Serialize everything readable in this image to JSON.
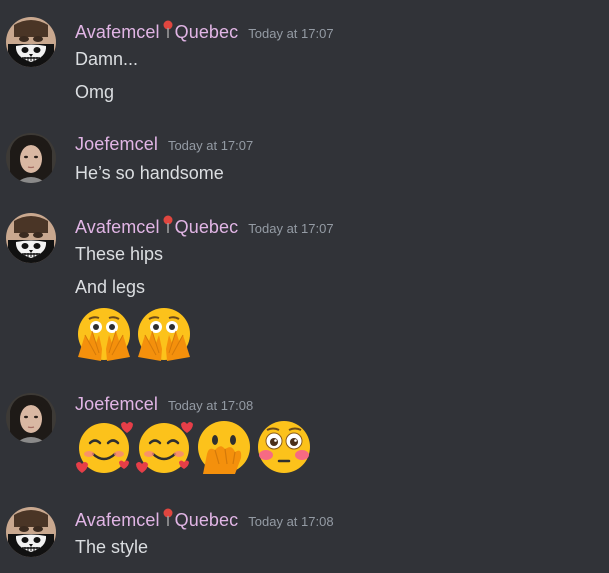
{
  "messages": [
    {
      "author": "Avafemcel",
      "location": "Quebec",
      "timestamp": "Today at 17:07",
      "lines": [
        "Damn...",
        "Omg"
      ]
    },
    {
      "author": "Joefemcel",
      "timestamp": "Today at 17:07",
      "lines": [
        "He’s so handsome"
      ]
    },
    {
      "author": "Avafemcel",
      "location": "Quebec",
      "timestamp": "Today at 17:07",
      "lines": [
        "These hips",
        "And legs"
      ],
      "emojis": [
        "face-with-open-eyes-and-hand-over-mouth",
        "face-with-open-eyes-and-hand-over-mouth"
      ]
    },
    {
      "author": "Joefemcel",
      "timestamp": "Today at 17:08",
      "emojis": [
        "smiling-face-with-hearts",
        "smiling-face-with-hearts",
        "face-with-hand-over-mouth",
        "flushed-face"
      ]
    },
    {
      "author": "Avafemcel",
      "location": "Quebec",
      "timestamp": "Today at 17:08",
      "lines": [
        "The style"
      ]
    }
  ],
  "colors": {
    "background": "#313338",
    "username": "#e1b5e5",
    "timestamp": "#949ba4",
    "text": "#dbdee1",
    "pin": "#e0463f"
  }
}
